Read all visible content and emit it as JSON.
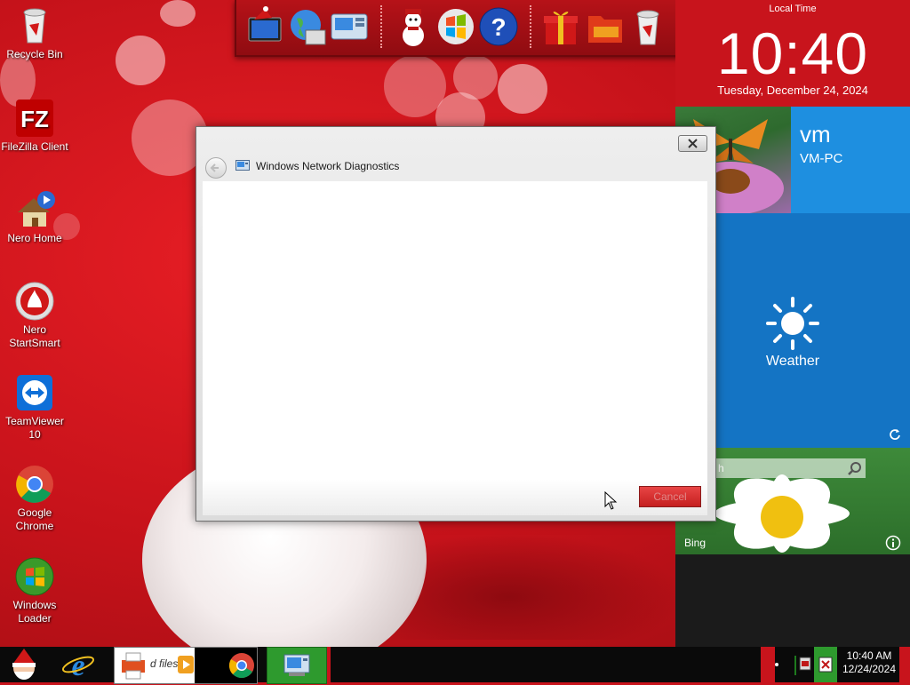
{
  "desktop": {
    "icons": [
      {
        "label": "Recycle Bin"
      },
      {
        "label": "FileZilla Client"
      },
      {
        "label": "Nero Home"
      },
      {
        "label": "Nero StartSmart"
      },
      {
        "label": "TeamViewer 10"
      },
      {
        "label": "Google Chrome"
      },
      {
        "label": "Windows Loader"
      }
    ]
  },
  "dock": {
    "items": [
      "christmas-monitor-icon",
      "internet-globe-icon",
      "network-icon",
      "snowman-icon",
      "windows-flag-icon",
      "help-icon",
      "gift-icon",
      "folder-icon",
      "recycle-bin-icon"
    ]
  },
  "clock_panel": {
    "local_time_label": "Local Time",
    "time": "10:40",
    "date": "Tuesday, December 24, 2024"
  },
  "tiles": {
    "user_name": "vm",
    "computer_name": "VM-PC",
    "weather_label": "Weather",
    "bing_label": "Bing",
    "bing_search_placeholder": "h"
  },
  "dialog": {
    "title": "Windows Network Diagnostics",
    "cancel_label": "Cancel"
  },
  "taskbar": {
    "pinned_partial_text": "d files",
    "tray_time": "10:40 AM",
    "tray_date": "12/24/2024"
  },
  "colors": {
    "accent_red": "#c8141c",
    "tile_blue": "#1e8fe0",
    "weather_blue": "#1474c4",
    "cancel_red": "#d42a2a"
  }
}
